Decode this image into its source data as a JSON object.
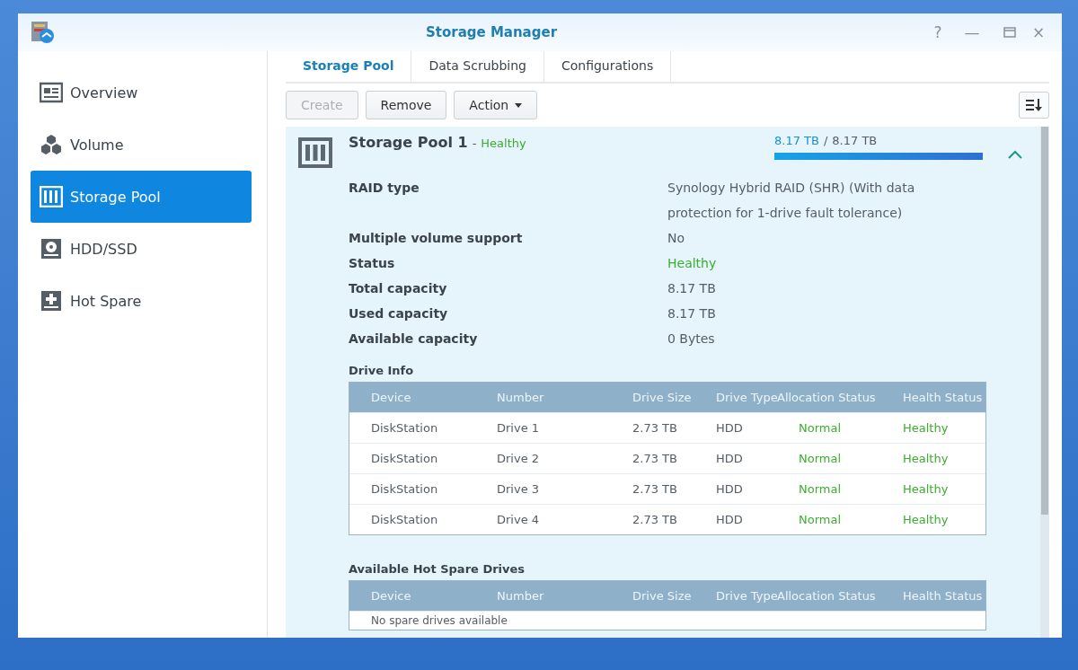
{
  "window": {
    "title": "Storage Manager",
    "controls": [
      "?",
      "—",
      "×"
    ]
  },
  "sidebar": {
    "items": [
      {
        "label": "Overview",
        "kind": "overview",
        "selected": false
      },
      {
        "label": "Volume",
        "kind": "volume",
        "selected": false
      },
      {
        "label": "Storage Pool",
        "kind": "pool",
        "selected": true
      },
      {
        "label": "HDD/SSD",
        "kind": "hdd",
        "selected": false
      },
      {
        "label": "Hot Spare",
        "kind": "spare",
        "selected": false
      }
    ]
  },
  "tabs": [
    {
      "label": "Storage Pool",
      "selected": true
    },
    {
      "label": "Data Scrubbing",
      "selected": false
    },
    {
      "label": "Configurations",
      "selected": false
    }
  ],
  "toolbar": {
    "buttons": [
      {
        "label": "Create",
        "disabled": true,
        "dropdown": false
      },
      {
        "label": "Remove",
        "disabled": false,
        "dropdown": false
      },
      {
        "label": "Action",
        "disabled": false,
        "dropdown": true
      }
    ]
  },
  "pool": {
    "name": "Storage Pool 1",
    "separator": "-",
    "status": "Healthy",
    "used": "8.17 TB",
    "slash": "/",
    "total": "8.17 TB",
    "level": 1.0,
    "expanded": true,
    "properties": [
      {
        "label": "RAID type",
        "value": "Synology Hybrid RAID (SHR) (With data protection for 1-drive fault tolerance)",
        "highlighted": false
      },
      {
        "label": "Multiple volume support",
        "value": "No",
        "highlighted": false
      },
      {
        "label": "Status",
        "value": "Healthy",
        "highlighted": true
      },
      {
        "label": "Total capacity",
        "value": "8.17 TB",
        "highlighted": false
      },
      {
        "label": "Used capacity",
        "value": "8.17 TB",
        "highlighted": false
      },
      {
        "label": "Available capacity",
        "value": "0 Bytes",
        "highlighted": false
      }
    ],
    "drive_info": {
      "title": "Drive Info",
      "columns": [
        "Device",
        "Number",
        "Drive Size",
        "Drive Type",
        "Allocation Status",
        "Health Status"
      ],
      "rows": [
        [
          "DiskStation",
          "Drive 1",
          "2.73 TB",
          "HDD",
          "Normal",
          "Healthy"
        ],
        [
          "DiskStation",
          "Drive 2",
          "2.73 TB",
          "HDD",
          "Normal",
          "Healthy"
        ],
        [
          "DiskStation",
          "Drive 3",
          "2.73 TB",
          "HDD",
          "Normal",
          "Healthy"
        ],
        [
          "DiskStation",
          "Drive 4",
          "2.73 TB",
          "HDD",
          "Normal",
          "Healthy"
        ]
      ]
    },
    "hot_spare": {
      "title": "Available Hot Spare Drives",
      "columns": [
        "Device",
        "Number",
        "Drive Size",
        "Drive Type",
        "Allocation Status",
        "Health Status"
      ],
      "empty_text": "No spare drives available"
    }
  }
}
